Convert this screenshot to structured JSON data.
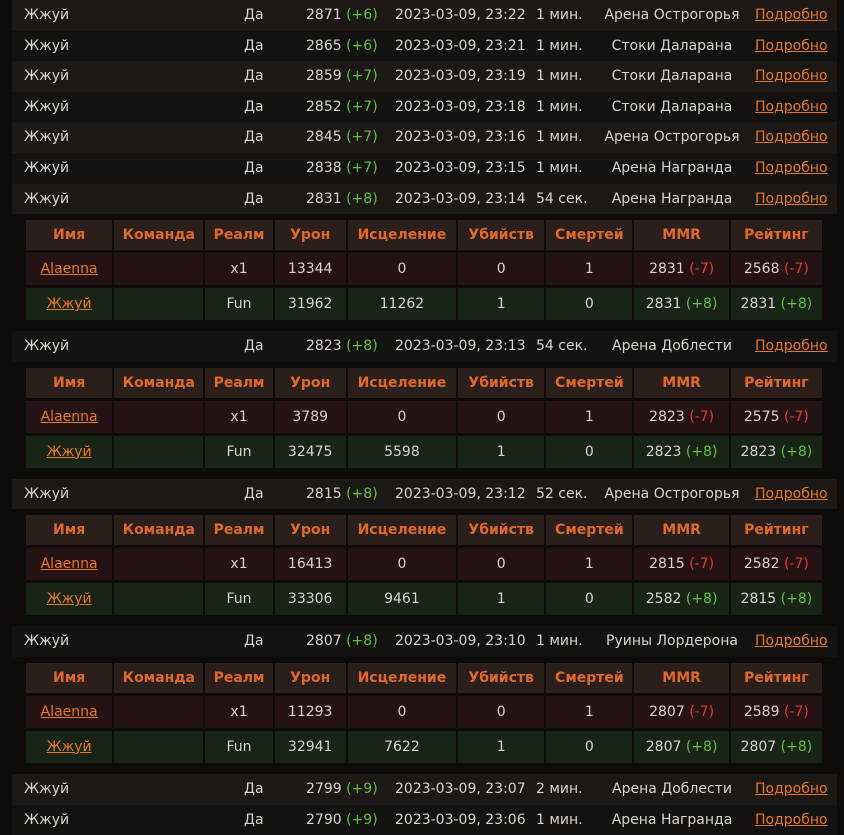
{
  "detail_header": [
    "Имя",
    "Команда",
    "Реалм",
    "Урон",
    "Исцеление",
    "Убийств",
    "Смертей",
    "MMR",
    "Рейтинг"
  ],
  "matches": [
    {
      "name": "Жжуй",
      "win": "Да",
      "rating": "2871",
      "delta": "(+6)",
      "date": "2023-03-09, 23:22",
      "duration": "1 мин.",
      "arena": "Арена Острогорья",
      "link": "Подробно"
    },
    {
      "name": "Жжуй",
      "win": "Да",
      "rating": "2865",
      "delta": "(+6)",
      "date": "2023-03-09, 23:21",
      "duration": "1 мин.",
      "arena": "Стоки Даларана",
      "link": "Подробно"
    },
    {
      "name": "Жжуй",
      "win": "Да",
      "rating": "2859",
      "delta": "(+7)",
      "date": "2023-03-09, 23:19",
      "duration": "1 мин.",
      "arena": "Стоки Даларана",
      "link": "Подробно"
    },
    {
      "name": "Жжуй",
      "win": "Да",
      "rating": "2852",
      "delta": "(+7)",
      "date": "2023-03-09, 23:18",
      "duration": "1 мин.",
      "arena": "Стоки Даларана",
      "link": "Подробно"
    },
    {
      "name": "Жжуй",
      "win": "Да",
      "rating": "2845",
      "delta": "(+7)",
      "date": "2023-03-09, 23:16",
      "duration": "1 мин.",
      "arena": "Арена Острогорья",
      "link": "Подробно"
    },
    {
      "name": "Жжуй",
      "win": "Да",
      "rating": "2838",
      "delta": "(+7)",
      "date": "2023-03-09, 23:15",
      "duration": "1 мин.",
      "arena": "Арена Награнда",
      "link": "Подробно"
    },
    {
      "name": "Жжуй",
      "win": "Да",
      "rating": "2831",
      "delta": "(+8)",
      "date": "2023-03-09, 23:14",
      "duration": "54 сек.",
      "arena": "Арена Награнда",
      "link": "Подробно",
      "players": [
        {
          "name": "Alaenna",
          "team": "",
          "realm": "x1",
          "damage": "13344",
          "healing": "0",
          "kills": "0",
          "deaths": "1",
          "mmr": "2831",
          "mmr_delta": "(-7)",
          "rating": "2568",
          "rating_delta": "(-7)",
          "result": "lose"
        },
        {
          "name": "Жжуй",
          "team": "",
          "realm": "Fun",
          "damage": "31962",
          "healing": "11262",
          "kills": "1",
          "deaths": "0",
          "mmr": "2831",
          "mmr_delta": "(+8)",
          "rating": "2831",
          "rating_delta": "(+8)",
          "result": "win"
        }
      ]
    },
    {
      "name": "Жжуй",
      "win": "Да",
      "rating": "2823",
      "delta": "(+8)",
      "date": "2023-03-09, 23:13",
      "duration": "54 сек.",
      "arena": "Арена Доблести",
      "link": "Подробно",
      "players": [
        {
          "name": "Alaenna",
          "team": "",
          "realm": "x1",
          "damage": "3789",
          "healing": "0",
          "kills": "0",
          "deaths": "1",
          "mmr": "2823",
          "mmr_delta": "(-7)",
          "rating": "2575",
          "rating_delta": "(-7)",
          "result": "lose"
        },
        {
          "name": "Жжуй",
          "team": "",
          "realm": "Fun",
          "damage": "32475",
          "healing": "5598",
          "kills": "1",
          "deaths": "0",
          "mmr": "2823",
          "mmr_delta": "(+8)",
          "rating": "2823",
          "rating_delta": "(+8)",
          "result": "win"
        }
      ]
    },
    {
      "name": "Жжуй",
      "win": "Да",
      "rating": "2815",
      "delta": "(+8)",
      "date": "2023-03-09, 23:12",
      "duration": "52 сек.",
      "arena": "Арена Острогорья",
      "link": "Подробно",
      "players": [
        {
          "name": "Alaenna",
          "team": "",
          "realm": "x1",
          "damage": "16413",
          "healing": "0",
          "kills": "0",
          "deaths": "1",
          "mmr": "2815",
          "mmr_delta": "(-7)",
          "rating": "2582",
          "rating_delta": "(-7)",
          "result": "lose"
        },
        {
          "name": "Жжуй",
          "team": "",
          "realm": "Fun",
          "damage": "33306",
          "healing": "9461",
          "kills": "1",
          "deaths": "0",
          "mmr": "2582",
          "mmr_delta": "(+8)",
          "rating": "2815",
          "rating_delta": "(+8)",
          "result": "win"
        }
      ]
    },
    {
      "name": "Жжуй",
      "win": "Да",
      "rating": "2807",
      "delta": "(+8)",
      "date": "2023-03-09, 23:10",
      "duration": "1 мин.",
      "arena": "Руины Лордерона",
      "link": "Подробно",
      "players": [
        {
          "name": "Alaenna",
          "team": "",
          "realm": "x1",
          "damage": "11293",
          "healing": "0",
          "kills": "0",
          "deaths": "1",
          "mmr": "2807",
          "mmr_delta": "(-7)",
          "rating": "2589",
          "rating_delta": "(-7)",
          "result": "lose"
        },
        {
          "name": "Жжуй",
          "team": "",
          "realm": "Fun",
          "damage": "32941",
          "healing": "7622",
          "kills": "1",
          "deaths": "0",
          "mmr": "2807",
          "mmr_delta": "(+8)",
          "rating": "2807",
          "rating_delta": "(+8)",
          "result": "win"
        }
      ]
    },
    {
      "name": "Жжуй",
      "win": "Да",
      "rating": "2799",
      "delta": "(+9)",
      "date": "2023-03-09, 23:07",
      "duration": "2 мин.",
      "arena": "Арена Доблести",
      "link": "Подробно"
    },
    {
      "name": "Жжуй",
      "win": "Да",
      "rating": "2790",
      "delta": "(+9)",
      "date": "2023-03-09, 23:06",
      "duration": "1 мин.",
      "arena": "Арена Награнда",
      "link": "Подробно"
    }
  ],
  "colors": {
    "accent": "#e8781f",
    "header_text": "#e0692a",
    "positive": "#5fc23a",
    "negative": "#e23a2a"
  }
}
